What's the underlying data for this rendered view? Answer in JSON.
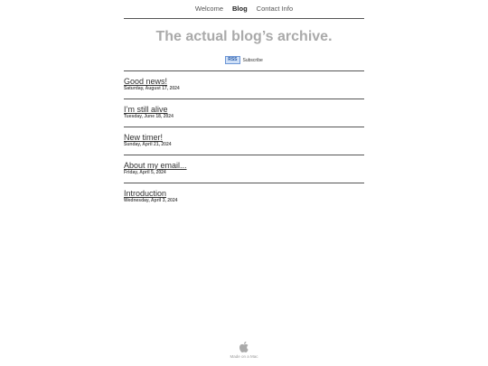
{
  "nav": {
    "items": [
      {
        "label": "Welcome",
        "active": false
      },
      {
        "label": "Blog",
        "active": true
      },
      {
        "label": "Contact Info",
        "active": false
      }
    ]
  },
  "header": {
    "title": "The actual blog’s archive.",
    "rss_badge": "RSS",
    "subscribe_label": "Subscribe"
  },
  "posts": [
    {
      "title": "Good news!",
      "date": "Saturday, August 17, 2024"
    },
    {
      "title": "I’m still alive",
      "date": "Tuesday, June 18, 2024"
    },
    {
      "title": "New timer!",
      "date": "Sunday, April 21, 2024"
    },
    {
      "title": "About my email...",
      "date": "Friday, April 5, 2024"
    },
    {
      "title": "Introduction",
      "date": "Wednesday, April 3, 2024"
    }
  ],
  "footer": {
    "icon": "apple-icon",
    "text": "Made on a Mac"
  },
  "colors": {
    "title": "#aaaaaa",
    "rule": "#555555",
    "rss_bg": "#cfe0f7",
    "rss_text": "#2457a6"
  }
}
